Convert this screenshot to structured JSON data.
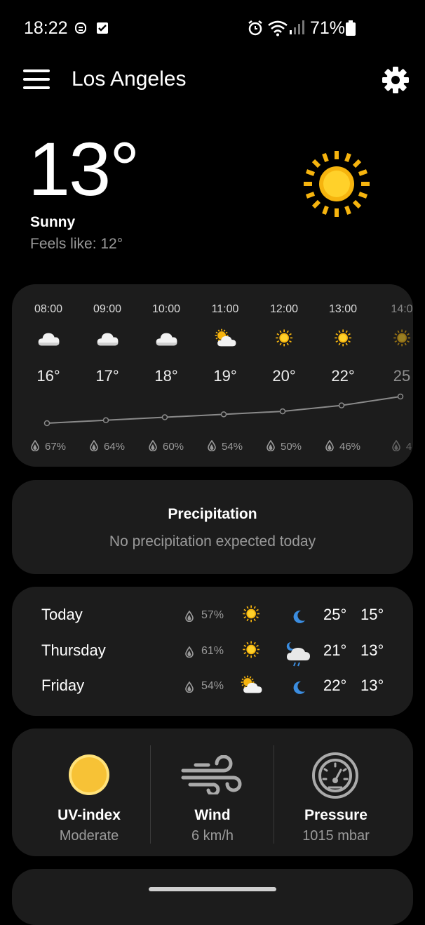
{
  "status": {
    "time": "18:22",
    "battery": "71%"
  },
  "header": {
    "city": "Los Angeles"
  },
  "current": {
    "temperature": "13°",
    "condition": "Sunny",
    "feels_like": "Feels like: 12°"
  },
  "hourly": [
    {
      "time": "08:00",
      "temp": "16°",
      "humidity": "67%",
      "icon": "cloud-icon"
    },
    {
      "time": "09:00",
      "temp": "17°",
      "humidity": "64%",
      "icon": "cloud-icon"
    },
    {
      "time": "10:00",
      "temp": "18°",
      "humidity": "60%",
      "icon": "cloud-icon"
    },
    {
      "time": "11:00",
      "temp": "19°",
      "humidity": "54%",
      "icon": "partly-sunny-icon"
    },
    {
      "time": "12:00",
      "temp": "20°",
      "humidity": "50%",
      "icon": "sun-icon"
    },
    {
      "time": "13:00",
      "temp": "22°",
      "humidity": "46%",
      "icon": "sun-icon"
    },
    {
      "time": "14:0",
      "temp": "25",
      "humidity": "4",
      "icon": "sun-icon"
    }
  ],
  "precipitation": {
    "title": "Precipitation",
    "text": "No precipitation expected today"
  },
  "daily": [
    {
      "day": "Today",
      "humidity": "57%",
      "day_icon": "sun-icon",
      "night_icon": "moon-icon",
      "high": "25°",
      "low": "15°"
    },
    {
      "day": "Thursday",
      "humidity": "61%",
      "day_icon": "sun-icon",
      "night_icon": "night-rain-cloud-icon",
      "high": "21°",
      "low": "13°"
    },
    {
      "day": "Friday",
      "humidity": "54%",
      "day_icon": "partly-sunny-icon",
      "night_icon": "moon-icon",
      "high": "22°",
      "low": "13°"
    }
  ],
  "details": {
    "uv": {
      "title": "UV-index",
      "value": "Moderate"
    },
    "wind": {
      "title": "Wind",
      "value": "6 km/h"
    },
    "pressure": {
      "title": "Pressure",
      "value": "1015 mbar"
    }
  },
  "colors": {
    "background": "#000000",
    "card": "#1c1c1c",
    "sun": "#f6b40e",
    "sun_core": "#ffd12a",
    "muted_text": "#9a9a9a",
    "moon": "#3b8de0"
  }
}
